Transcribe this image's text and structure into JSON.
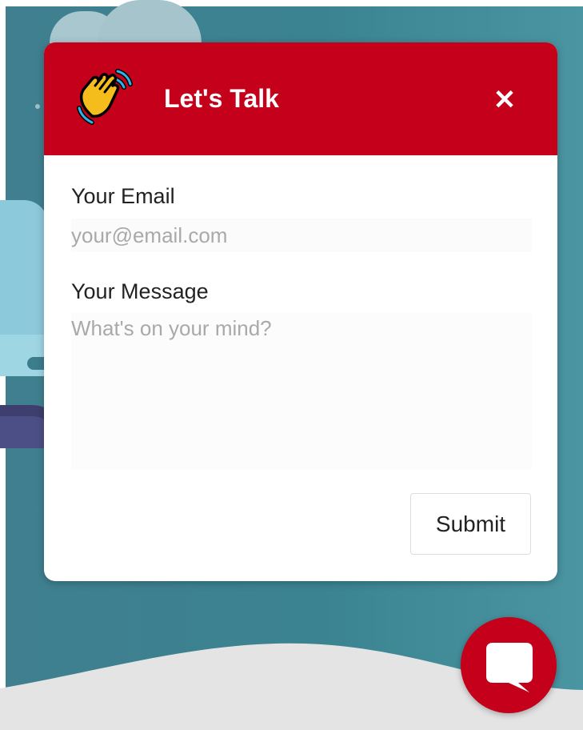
{
  "chat_widget": {
    "title": "Let's Talk",
    "close_label": "✕",
    "email": {
      "label": "Your Email",
      "placeholder": "your@email.com",
      "value": ""
    },
    "message": {
      "label": "Your Message",
      "placeholder": "What's on your mind?",
      "value": ""
    },
    "submit_label": "Submit"
  },
  "icons": {
    "header_icon": "waving-hand-icon",
    "close_icon": "close-icon",
    "launcher_icon": "chat-bubble-icon"
  },
  "colors": {
    "brand_red": "#c4001a",
    "background_teal": "#3b8391",
    "ground": "#e4e4e4",
    "wave_hand": "#f2b618"
  }
}
